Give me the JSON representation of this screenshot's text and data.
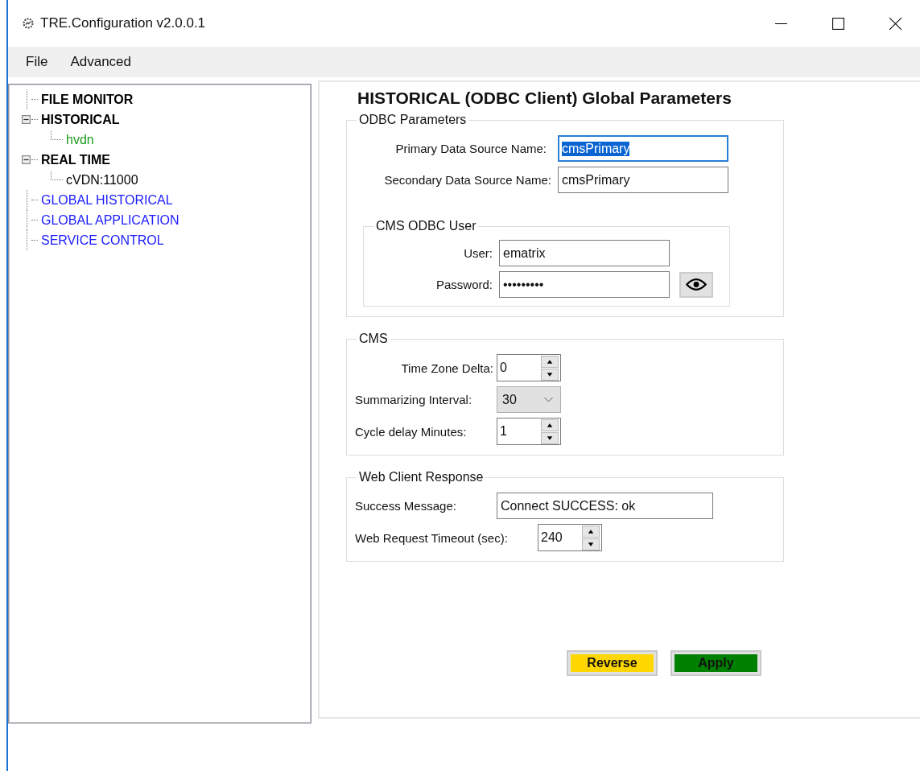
{
  "window": {
    "title": "TRE.Configuration v2.0.0.1"
  },
  "menu": [
    "File",
    "Advanced"
  ],
  "tree": [
    {
      "label": "FILE MONITOR",
      "kind": "section",
      "color": "#000000"
    },
    {
      "label": "HISTORICAL",
      "kind": "section",
      "color": "#000000",
      "expanded": true,
      "children": [
        {
          "label": "hvdn",
          "color": "#1a9a1a"
        }
      ]
    },
    {
      "label": "REAL TIME",
      "kind": "section",
      "color": "#000000",
      "expanded": true,
      "children": [
        {
          "label": "cVDN:11000",
          "color": "#000000"
        }
      ]
    },
    {
      "label": "GLOBAL HISTORICAL",
      "kind": "node",
      "color": "#1a1aff"
    },
    {
      "label": "GLOBAL APPLICATION",
      "kind": "node",
      "color": "#1a1aff"
    },
    {
      "label": "SERVICE CONTROL",
      "kind": "node",
      "color": "#1a1aff"
    }
  ],
  "heading": "HISTORICAL (ODBC Client) Global Parameters",
  "groups": [
    {
      "legend": "ODBC Parameters",
      "fields": [
        {
          "label": "Primary Data Source Name:",
          "kind": "text",
          "value": "cmsPrimary",
          "focused": true
        },
        {
          "label": "Secondary Data Source Name:",
          "kind": "text",
          "value": "cmsPrimary",
          "focused": false
        }
      ],
      "subgroup": {
        "legend": "CMS ODBC User",
        "fields": [
          {
            "label": "User:",
            "kind": "text",
            "value": "ematrix",
            "focused": false
          },
          {
            "label": "Password:",
            "kind": "password",
            "value": "•••••••••",
            "focused": false
          }
        ]
      }
    },
    {
      "legend": "CMS",
      "fields": [
        {
          "label": "Time Zone Delta:",
          "kind": "spin",
          "value": "0"
        },
        {
          "label": "Summarizing Interval:",
          "kind": "combo",
          "value": "30"
        },
        {
          "label": "Cycle delay Minutes:",
          "kind": "spin",
          "value": "1"
        }
      ]
    },
    {
      "legend": "Web Client Response",
      "fields": [
        {
          "label": "Success Message:",
          "kind": "text",
          "value": "Connect SUCCESS: ok",
          "focused": false
        },
        {
          "label": "Web Request Timeout (sec):",
          "kind": "spin",
          "value": "240"
        }
      ]
    }
  ],
  "buttons": [
    {
      "label": "Reverse",
      "color": "#ffd700"
    },
    {
      "label": "Apply",
      "color": "#008000"
    }
  ]
}
